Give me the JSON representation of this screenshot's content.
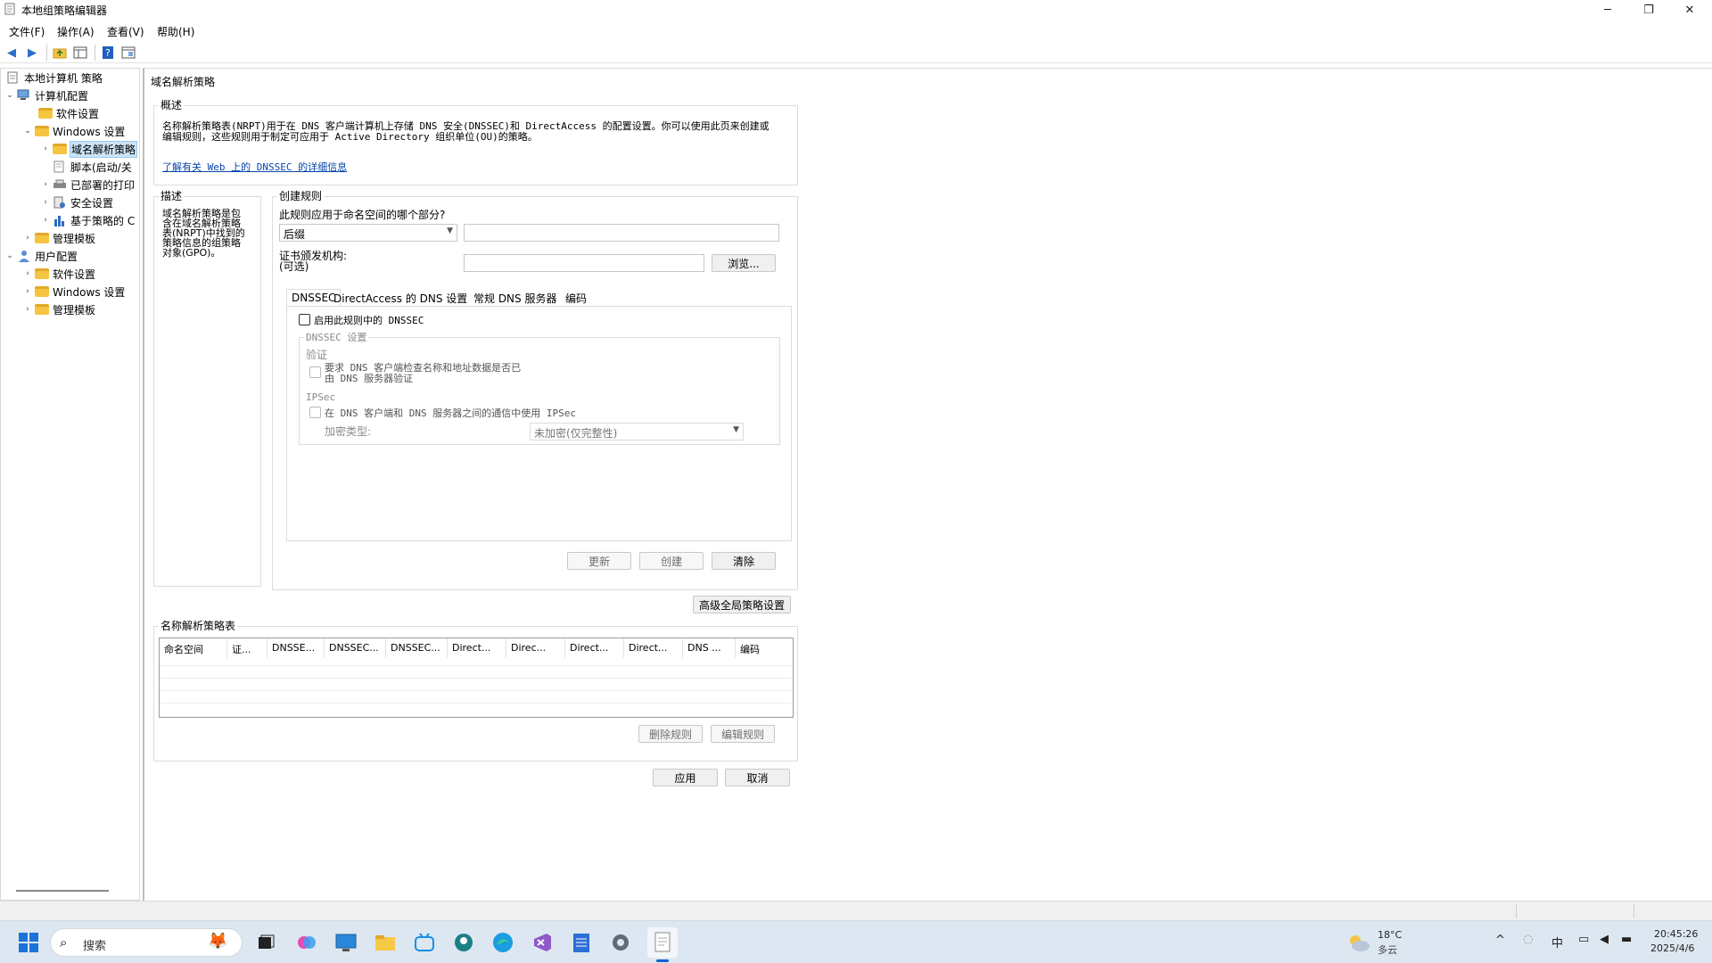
{
  "window": {
    "title": "本地组策略编辑器"
  },
  "window_controls": {
    "minimize": "─",
    "restore": "❐",
    "close": "✕"
  },
  "menu": [
    "文件(F)",
    "操作(A)",
    "查看(V)",
    "帮助(H)"
  ],
  "tree": [
    {
      "label": "本地计算机 策略",
      "level": 0,
      "twist": ""
    },
    {
      "label": "计算机配置",
      "level": 0,
      "twist": "v"
    },
    {
      "label": "软件设置",
      "level": 1,
      "twist": ""
    },
    {
      "label": "Windows 设置",
      "level": 1,
      "twist": "v"
    },
    {
      "label": "域名解析策略",
      "level": 2,
      "twist": ">"
    },
    {
      "label": "脚本(启动/关",
      "level": 2,
      "twist": ""
    },
    {
      "label": "已部署的打印",
      "level": 2,
      "twist": ">"
    },
    {
      "label": "安全设置",
      "level": 2,
      "twist": ">"
    },
    {
      "label": "基于策略的 C",
      "level": 2,
      "twist": ">"
    },
    {
      "label": "管理模板",
      "level": 1,
      "twist": ">"
    },
    {
      "label": "用户配置",
      "level": 0,
      "twist": "v"
    },
    {
      "label": "软件设置",
      "level": 1,
      "twist": ">"
    },
    {
      "label": "Windows 设置",
      "level": 1,
      "twist": ">"
    },
    {
      "label": "管理模板",
      "level": 1,
      "twist": ">"
    }
  ],
  "main": {
    "heading": "域名解析策略",
    "overview": {
      "title": "概述",
      "text_line1": "名称解析策略表(NRPT)用于在 DNS 客户端计算机上存储 DNS 安全(DNSSEC)和 DirectAccess 的配置设置。你可以使用此页来创建或",
      "text_line2": "编辑规则，这些规则用于制定可应用于 Active Directory 组织单位(OU)的策略。",
      "link": "了解有关 Web 上的 DNSSEC 的详细信息"
    },
    "description": {
      "title": "描述",
      "lines": [
        "域名解析策略是包",
        "含在域名解析策略",
        "表(NRPT)中找到的",
        "策略信息的组策略",
        "对象(GPO)。"
      ]
    },
    "create_rule": {
      "title": "创建规则",
      "question": "此规则应用于命名空间的哪个部分?",
      "combo_value": "后缀",
      "cert_label_1": "证书颁发机构:",
      "cert_label_2": "(可选)",
      "browse": "浏览...",
      "tabs": [
        "DNSSEC",
        "DirectAccess 的 DNS 设置",
        "常规 DNS 服务器",
        "编码"
      ],
      "enable_dnssec": "启用此规则中的 DNSSEC",
      "dnssec_settings": "DNSSEC 设置",
      "validation": "验证",
      "require_validation_1": "要求 DNS 客户端检查名称和地址数据是否已",
      "require_validation_2": "由 DNS 服务器验证",
      "ipsec": "IPSec",
      "use_ipsec": "在 DNS 客户端和 DNS 服务器之间的通信中使用 IPSec",
      "encryption_label": "加密类型:",
      "encryption_value": "未加密(仅完整性)",
      "update": "更新",
      "create": "创建",
      "clear": "清除"
    },
    "advanced_global": "高级全局策略设置",
    "nrpt": {
      "title": "名称解析策略表",
      "columns": [
        "命名空间",
        "证...",
        "DNSSE...",
        "DNSSEC...",
        "DNSSEC...",
        "Direct...",
        "Direc...",
        "Direct...",
        "Direct...",
        "DNS ...",
        "编码"
      ],
      "delete_rule": "删除规则",
      "edit_rule": "编辑规则"
    },
    "apply": "应用",
    "cancel": "取消"
  },
  "taskbar": {
    "search_placeholder": "搜索",
    "weather_temp": "18°C",
    "weather_desc": "多云",
    "ime": "中",
    "time": "20:45:26",
    "date": "2025/4/6"
  }
}
